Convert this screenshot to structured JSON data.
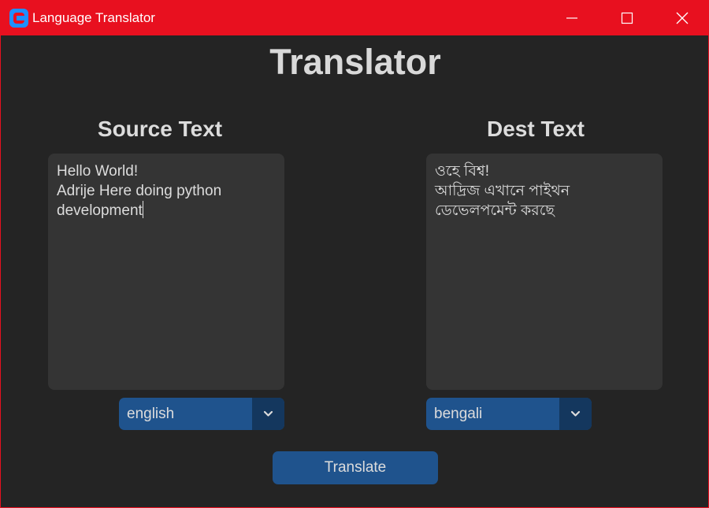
{
  "window": {
    "title": "Language Translator",
    "accent_color": "#e8101f",
    "background_color": "#242424"
  },
  "titlebar": {
    "minimize_icon": "minimize-icon",
    "maximize_icon": "maximize-icon",
    "close_icon": "close-icon"
  },
  "header": {
    "title": "Translator"
  },
  "source": {
    "label": "Source Text",
    "text": "Hello World!\nAdrije Here doing python\ndevelopment",
    "language": "english"
  },
  "destination": {
    "label": "Dest Text",
    "text": "ওহে বিশ্ব!\nআদ্রিজ এখানে পাইথন\nডেভেলপমেন্ট করছে",
    "language": "bengali"
  },
  "actions": {
    "translate_label": "Translate",
    "button_color": "#1f538d"
  }
}
